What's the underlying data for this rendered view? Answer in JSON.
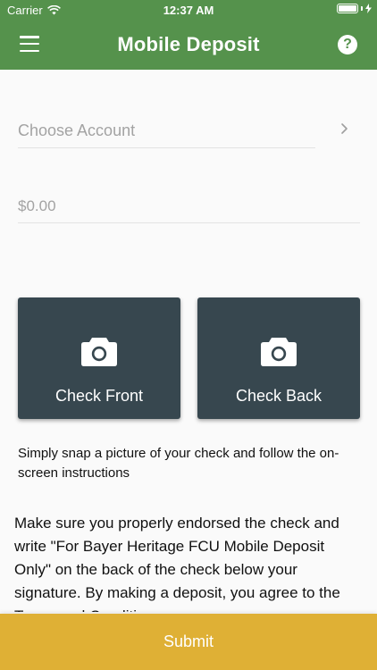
{
  "status_bar": {
    "carrier": "Carrier",
    "time": "12:37 AM",
    "battery_level": 1.0
  },
  "header": {
    "title": "Mobile Deposit",
    "background_color": "#55924c",
    "menu_icon": "hamburger-menu-icon",
    "help_icon": "question-circle-icon",
    "help_glyph": "?"
  },
  "form": {
    "account_placeholder": "Choose Account",
    "amount_placeholder": "$0.00"
  },
  "capture": {
    "front_label": "Check Front",
    "back_label": "Check Back",
    "card_color": "#37474f",
    "icon": "camera-icon"
  },
  "hint_text": "Simply snap a picture of your check and follow the on-screen instructions",
  "disclaimer_text": "Make sure you properly endorsed the check and write \"For Bayer Heritage FCU Mobile Deposit Only\" on the back of the check below your signature. By making a deposit, you agree to the Terms and Conditions.",
  "submit": {
    "label": "Submit",
    "color": "#dfb035"
  }
}
